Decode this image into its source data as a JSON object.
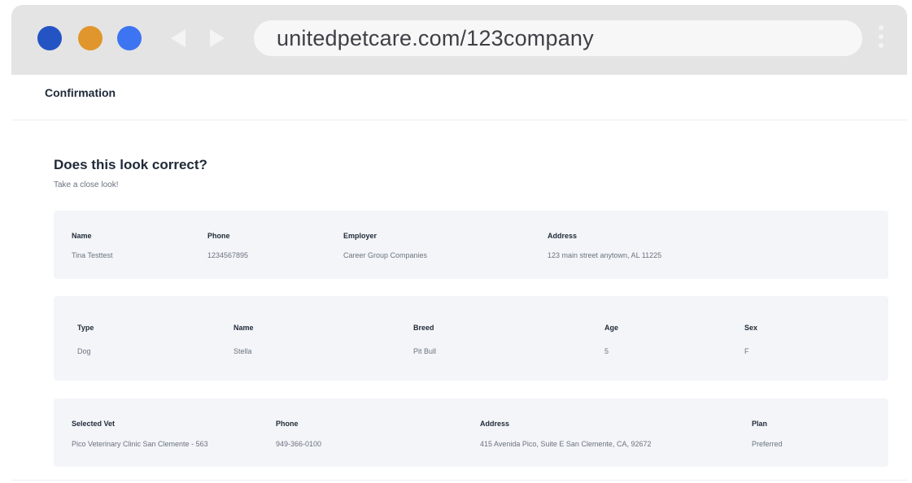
{
  "browser": {
    "url": "unitedpetcare.com/123company",
    "dots": [
      "#2453c4",
      "#e0962c",
      "#3d74f2"
    ],
    "back_icon": "chevron-left-icon",
    "forward_icon": "chevron-right-icon",
    "menu_icon": "kebab-menu-icon"
  },
  "page": {
    "step_title": "Confirmation",
    "heading": "Does this look correct?",
    "subheading": "Take a close look!"
  },
  "member": {
    "name_label": "Name",
    "name_value": "Tina Testtest",
    "phone_label": "Phone",
    "phone_value": "1234567895",
    "employer_label": "Employer",
    "employer_value": "Career Group Companies",
    "address_label": "Address",
    "address_value": "123 main street anytown, AL 11225"
  },
  "pet": {
    "type_label": "Type",
    "type_value": "Dog",
    "name_label": "Name",
    "name_value": "Stella",
    "breed_label": "Breed",
    "breed_value": "Pit Bull",
    "age_label": "Age",
    "age_value": "5",
    "sex_label": "Sex",
    "sex_value": "F"
  },
  "vet": {
    "vet_label": "Selected Vet",
    "vet_value": "Pico Veterinary Clinic San Clemente - 563",
    "phone_label": "Phone",
    "phone_value": "949-366-0100",
    "address_label": "Address",
    "address_value": "415 Avenida Pico, Suite E San Clemente, CA, 92672",
    "plan_label": "Plan",
    "plan_value": "Preferred"
  }
}
